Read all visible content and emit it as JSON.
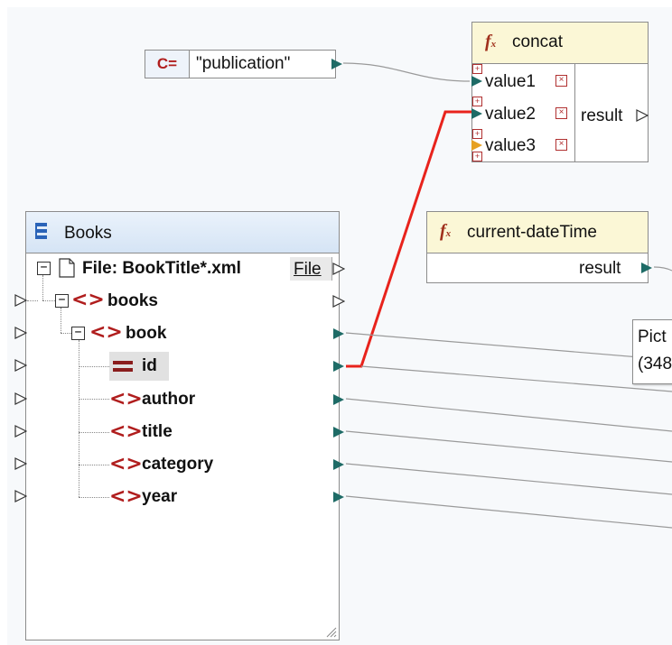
{
  "constant": {
    "type_label": "C=",
    "value": "\"publication\""
  },
  "concat": {
    "fx_symbol": "fx",
    "title": "concat",
    "inputs": [
      "value1",
      "value2",
      "value3"
    ],
    "output": "result"
  },
  "current_datetime": {
    "fx_symbol": "fx",
    "title": "current-dateTime",
    "output": "result"
  },
  "books": {
    "title": "Books",
    "file_label": "File: BookTitle*.xml",
    "file_button": "File",
    "nodes": [
      {
        "label": "books"
      },
      {
        "label": "book"
      },
      {
        "label": "id"
      },
      {
        "label": "author"
      },
      {
        "label": "title"
      },
      {
        "label": "category"
      },
      {
        "label": "year"
      }
    ]
  },
  "tooltip": {
    "line1": "Pict",
    "line2": "(348"
  },
  "colors": {
    "connection_active": "#e8231c",
    "connection": "#9a9a9a",
    "port_filled": "#1e6b66",
    "port_optional": "#e6a122",
    "element_icon": "#b01d1d",
    "function_header": "#fbf7d6",
    "component_header": "#dce8f6"
  }
}
